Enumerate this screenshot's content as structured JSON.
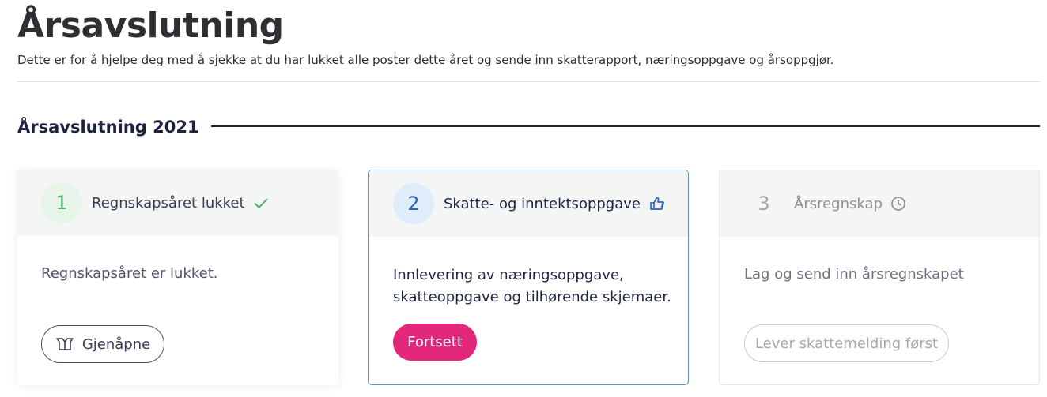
{
  "page": {
    "title": "Årsavslutning",
    "description": "Dette er for å hjelpe deg med å sjekke at du har lukket alle poster dette året og sende inn skatterapport, næringsoppgave og årsoppgjør."
  },
  "section": {
    "title": "Årsavslutning 2021"
  },
  "steps": [
    {
      "number": "1",
      "label": "Regnskapsåret lukket",
      "status_icon": "checkmark-icon",
      "body": "Regnskapsåret er lukket.",
      "button_label": "Gjenåpne",
      "button_icon": "open-box-icon",
      "accent_color": "#56b26b"
    },
    {
      "number": "2",
      "label": "Skatte- og inntektsoppgave",
      "status_icon": "pointing-hand-icon",
      "body": "Innlevering av næringsoppgave, skatteoppgave og tilhørende skjemaer.",
      "button_label": "Fortsett",
      "accent_color": "#2d65b8",
      "button_color": "#e3287c"
    },
    {
      "number": "3",
      "label": "Årsregnskap",
      "status_icon": "clock-icon",
      "body": "Lag og send inn årsregnskapet",
      "button_label": "Lever skattemelding først",
      "accent_color": "#a4a6ab"
    }
  ]
}
